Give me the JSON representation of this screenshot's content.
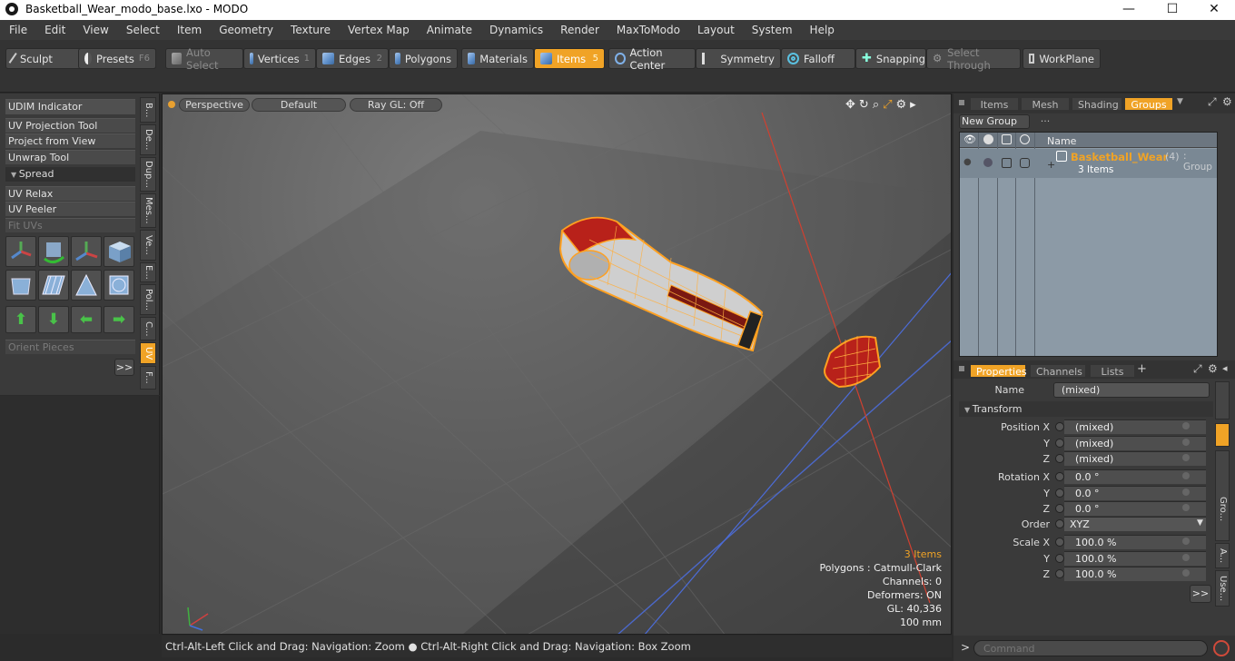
{
  "window": {
    "title": "Basketball_Wear_modo_base.lxo - MODO",
    "minimize": "—",
    "maximize": "☐",
    "close": "✕"
  },
  "menu": [
    "File",
    "Edit",
    "View",
    "Select",
    "Item",
    "Geometry",
    "Texture",
    "Vertex Map",
    "Animate",
    "Dynamics",
    "Render",
    "MaxToModo",
    "Layout",
    "System",
    "Help"
  ],
  "toolbar": {
    "sculpt": "Sculpt",
    "presets": "Presets",
    "presets_hotkey": "F6",
    "auto_select": "Auto Select",
    "vertices": "Vertices",
    "vertices_hotkey": "1",
    "edges": "Edges",
    "edges_hotkey": "2",
    "polygons": "Polygons",
    "materials": "Materials",
    "items": "Items",
    "items_hotkey": "5",
    "action_center": "Action Center",
    "symmetry": "Symmetry",
    "falloff": "Falloff",
    "snapping": "Snapping",
    "select_through": "Select Through",
    "workplane": "WorkPlane"
  },
  "left": {
    "buttons": [
      "UDIM Indicator",
      "UV Projection Tool",
      "Project from View",
      "Unwrap Tool"
    ],
    "spread_header": "Spread",
    "buttons2": [
      "UV Relax",
      "UV Peeler",
      "Fit UVs"
    ],
    "orient": "Orient Pieces",
    "more": ">>",
    "vtabs": [
      "B...",
      "De...",
      "Dup...",
      "Mes...",
      "Ve...",
      "E...",
      "Pol...",
      "C...",
      "UV",
      "F..."
    ]
  },
  "viewport": {
    "perspective": "Perspective",
    "default": "Default",
    "raygl": "Ray GL: Off",
    "info_items": "3 Items",
    "info_polygons": "Polygons : Catmull-Clark",
    "info_channels": "Channels: 0",
    "info_deformers": "Deformers: ON",
    "info_gl": "GL: 40,336",
    "info_scale": "100 mm"
  },
  "status": "Ctrl-Alt-Left Click and Drag: Navigation: Zoom ● Ctrl-Alt-Right Click and Drag: Navigation: Box Zoom",
  "groups": {
    "tabs": [
      "Items",
      "Mesh ...",
      "Shading",
      "Groups"
    ],
    "new_group": "New Group",
    "col_name": "Name",
    "item_name": "Basketball_Wear",
    "item_count": "(4)",
    "item_type": ": Group",
    "item_sub": "3 Items"
  },
  "properties": {
    "tabs": [
      "Properties",
      "Channels",
      "Lists"
    ],
    "add_tab": "+",
    "name_label": "Name",
    "name_value": "(mixed)",
    "transform_header": "Transform",
    "rows": [
      {
        "label": "Position X",
        "value": "(mixed)"
      },
      {
        "label": "Y",
        "value": "(mixed)"
      },
      {
        "label": "Z",
        "value": "(mixed)"
      },
      {
        "label": "Rotation X",
        "value": "0.0 °"
      },
      {
        "label": "Y",
        "value": "0.0 °"
      },
      {
        "label": "Z",
        "value": "0.0 °"
      },
      {
        "label": "Order",
        "value": "XYZ"
      },
      {
        "label": "Scale X",
        "value": "100.0 %"
      },
      {
        "label": "Y",
        "value": "100.0 %"
      },
      {
        "label": "Z",
        "value": "100.0 %"
      }
    ],
    "more": ">>",
    "rvtabs": [
      "Gro...",
      "A...",
      "Use..."
    ]
  },
  "command": {
    "prompt": ">",
    "placeholder": "Command"
  }
}
